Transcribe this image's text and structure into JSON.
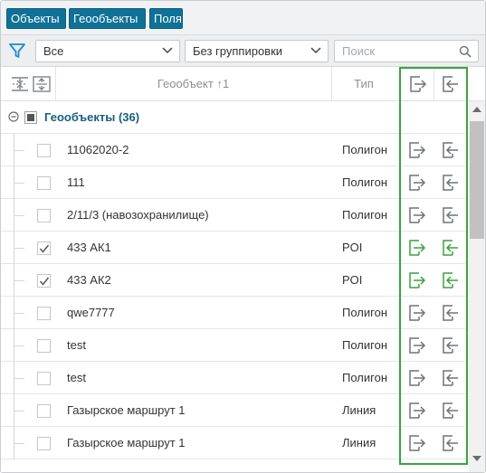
{
  "tabs": [
    {
      "label": "Объекты"
    },
    {
      "label": "Геообъекты"
    },
    {
      "label": "Поля"
    }
  ],
  "toolbar": {
    "filter_icon": "filter-icon",
    "filter_select": "Все",
    "grouping_select": "Без группировки",
    "search_placeholder": "Поиск"
  },
  "header": {
    "geo_column": "Геообъект ↑1",
    "type_column": "Тип"
  },
  "group": {
    "label": "Геообъекты (36)"
  },
  "rows": [
    {
      "name": "11062020-2",
      "type": "Полигон",
      "checked": false
    },
    {
      "name": "111",
      "type": "Полигон",
      "checked": false
    },
    {
      "name": "2/11/3 (навозохранилище)",
      "type": "Полигон",
      "checked": false
    },
    {
      "name": "433 АК1",
      "type": "POI",
      "checked": true
    },
    {
      "name": "433 АК2",
      "type": "POI",
      "checked": true
    },
    {
      "name": "qwe7777",
      "type": "Полигон",
      "checked": false
    },
    {
      "name": "test",
      "type": "Полигон",
      "checked": false
    },
    {
      "name": "test",
      "type": "Полигон",
      "checked": false
    },
    {
      "name": "Газырское маршрут 1",
      "type": "Линия",
      "checked": false
    },
    {
      "name": "Газырское маршрут 1",
      "type": "Линия",
      "checked": false
    }
  ],
  "colors": {
    "tab_bg": "#0f7196",
    "group_label": "#17607f",
    "export_active": "#3aa23c",
    "export_inactive": "#6f7479",
    "highlight": "#38a53b"
  }
}
